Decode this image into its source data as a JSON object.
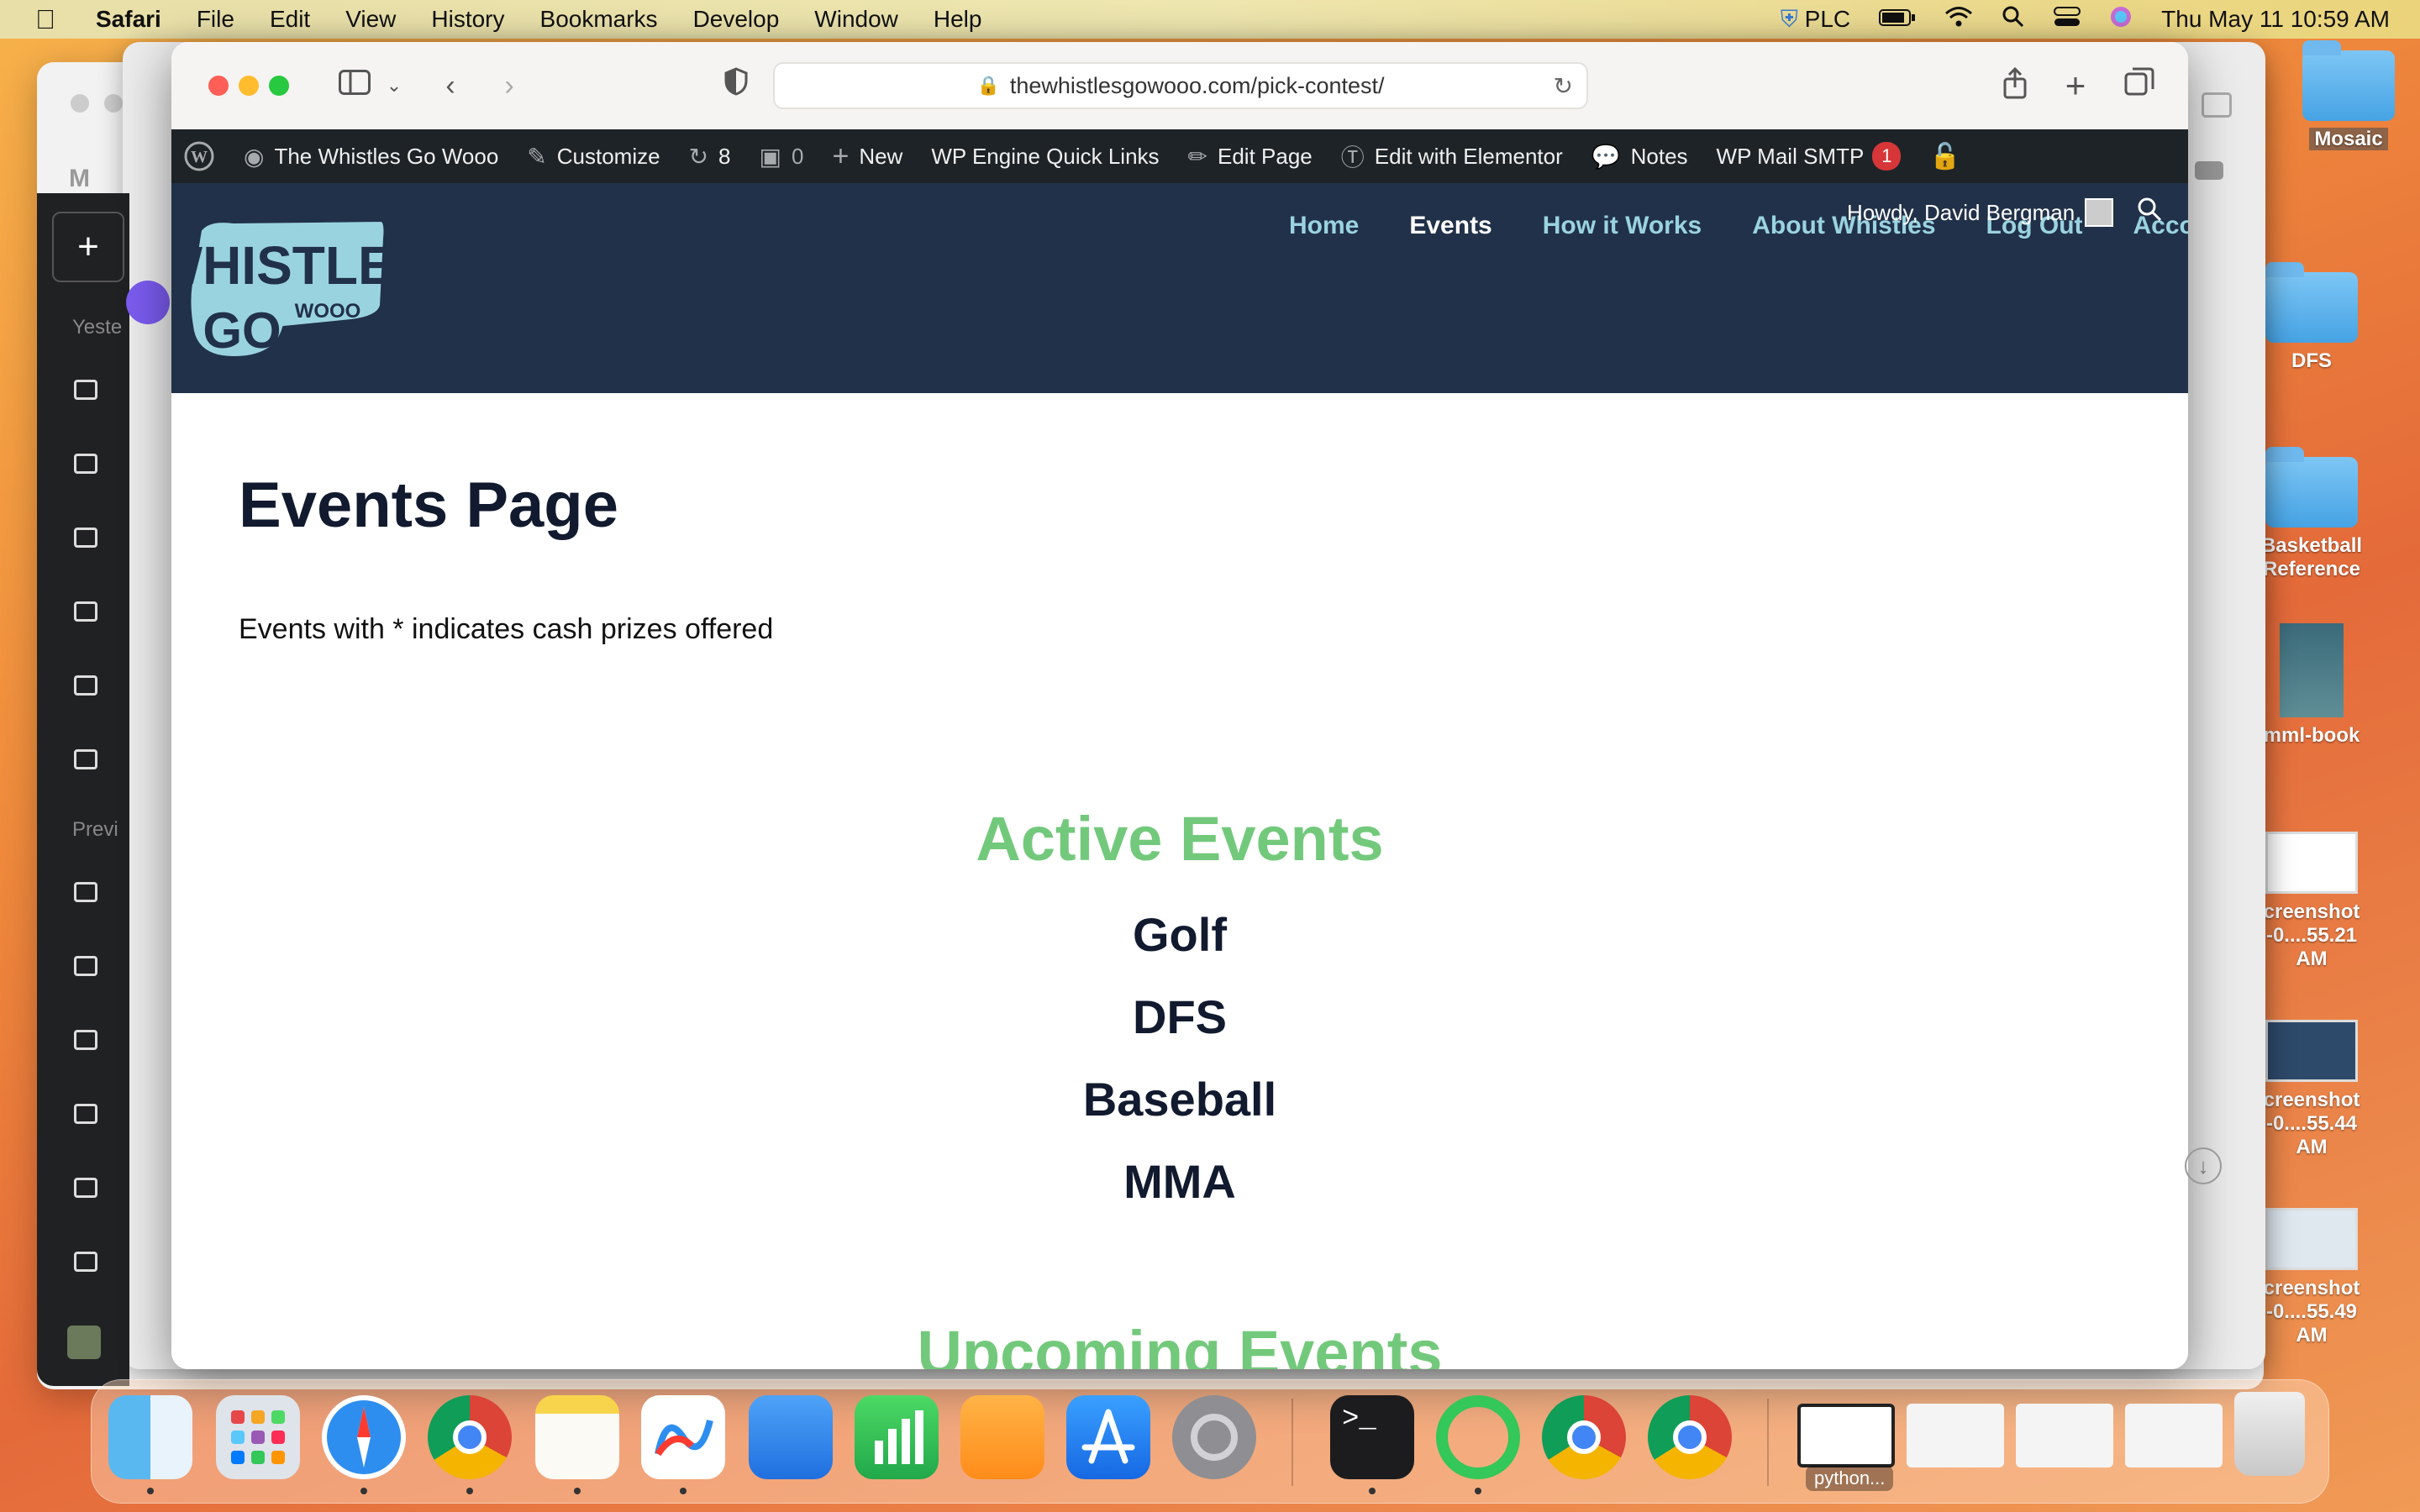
{
  "menubar": {
    "app_name": "Safari",
    "menus": [
      "File",
      "Edit",
      "View",
      "History",
      "Bookmarks",
      "Develop",
      "Window",
      "Help"
    ],
    "status_vpn": "PLC",
    "datetime": "Thu May 11  10:59 AM"
  },
  "desktop": {
    "items": [
      {
        "label": "Mosaic"
      },
      {
        "label": "DFS"
      },
      {
        "label": "Basketball Reference"
      },
      {
        "label": "mml-book"
      },
      {
        "label": "creenshot -0....55.21 AM"
      },
      {
        "label": "creenshot -0....55.44 AM"
      },
      {
        "label": "creenshot -0....55.49 AM"
      }
    ]
  },
  "bg_sidebar": {
    "label_yesterday": "Yeste",
    "label_previous": "Previ"
  },
  "safari": {
    "url": "thewhistlesgowooo.com/pick-contest/"
  },
  "wp_admin_bar": {
    "site_name": "The Whistles Go Wooo",
    "customize": "Customize",
    "updates_count": "8",
    "comments_count": "0",
    "new": "New",
    "quick_links": "WP Engine Quick Links",
    "edit_page": "Edit Page",
    "elementor": "Edit with Elementor",
    "notes": "Notes",
    "smtp": "WP Mail SMTP",
    "smtp_badge": "1"
  },
  "site_header": {
    "logo_text_top": "WHISTLES",
    "logo_text_bottom": "GO",
    "logo_text_small": "WOOO",
    "nav": [
      "Home",
      "Events",
      "How it Works",
      "About Whistles",
      "Log Out",
      "Account"
    ],
    "active_nav": "Events",
    "howdy": "Howdy, David Bergman"
  },
  "content": {
    "title": "Events Page",
    "notice": "Events with * indicates cash prizes offered",
    "active_heading": "Active Events",
    "active_events": [
      "Golf",
      "DFS",
      "Baseball",
      "MMA"
    ],
    "upcoming_heading": "Upcoming Events"
  },
  "dock": {
    "apps": [
      "Finder",
      "Launchpad",
      "Safari",
      "Chrome",
      "Notes",
      "Freeform",
      "Keynote",
      "Numbers",
      "Pages",
      "App Store",
      "System Settings",
      "Terminal",
      "Activity",
      "Chrome",
      "Chrome"
    ],
    "window_label": "python..."
  },
  "colors": {
    "site_header_bg": "#213149",
    "accent_green": "#73c97b",
    "nav_link": "#9ad3e0",
    "wp_bar_bg": "#1d2327"
  }
}
